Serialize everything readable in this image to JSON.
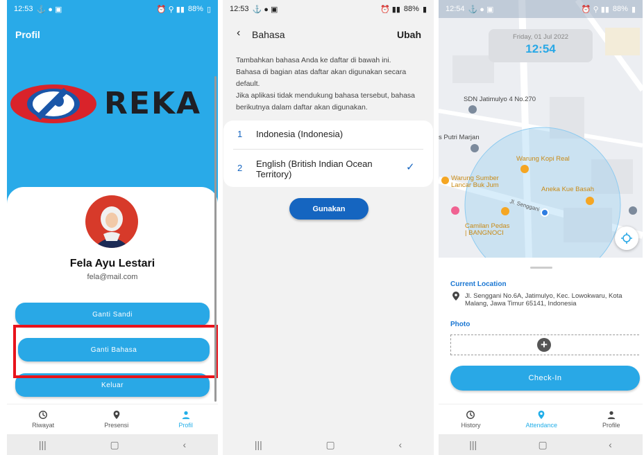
{
  "colors": {
    "brand_blue": "#29a8e6",
    "logo_red": "#d9232a",
    "dark_blue": "#1565c0",
    "highlight_red": "#e8131b"
  },
  "screen1": {
    "status": {
      "time": "12:53",
      "battery": "88%"
    },
    "title": "Profil",
    "logo_text": "REKA",
    "name": "Fela Ayu Lestari",
    "email": "fela@mail.com",
    "buttons": {
      "change_password": "Ganti Sandi",
      "change_language": "Ganti Bahasa",
      "logout": "Keluar"
    },
    "nav": {
      "history": "Riwayat",
      "presence": "Presensi",
      "profile": "Profil"
    }
  },
  "screen2": {
    "status": {
      "time": "12:53",
      "battery": "88%"
    },
    "title": "Bahasa",
    "edit": "Ubah",
    "description": "Tambahkan bahasa Anda ke daftar di bawah ini. Bahasa di bagian atas daftar akan digunakan secara default.\nJika aplikasi tidak mendukung bahasa tersebut, bahasa berikutnya dalam daftar akan digunakan.",
    "languages": [
      {
        "index": "1",
        "name": "Indonesia (Indonesia)"
      },
      {
        "index": "2",
        "name": "English (British Indian Ocean Territory)"
      }
    ],
    "apply_button": "Gunakan"
  },
  "screen3": {
    "status": {
      "time": "12:54",
      "battery": "88%"
    },
    "date": "Friday, 01 Jul 2022",
    "time": "12:54",
    "map_labels": {
      "school": "SDN Jatimulyo 4 No.270",
      "putri": "s Putri Marjan",
      "kopi": "Warung Kopi Real",
      "sumber": "Warung Sumber\nLancar Buk Jum",
      "kue": "Aneka Kue Basah",
      "street": "Jl. Senggani",
      "camilan": "Camilan Pedas\n| BANGNOCI"
    },
    "current_location_label": "Current Location",
    "address": "Jl. Senggani No.6A, Jatimulyo, Kec. Lowokwaru, Kota Malang, Jawa Timur 65141, Indonesia",
    "photo_label": "Photo",
    "checkin_button": "Check-In",
    "nav": {
      "history": "History",
      "attendance": "Attendance",
      "profile": "Profile"
    }
  }
}
